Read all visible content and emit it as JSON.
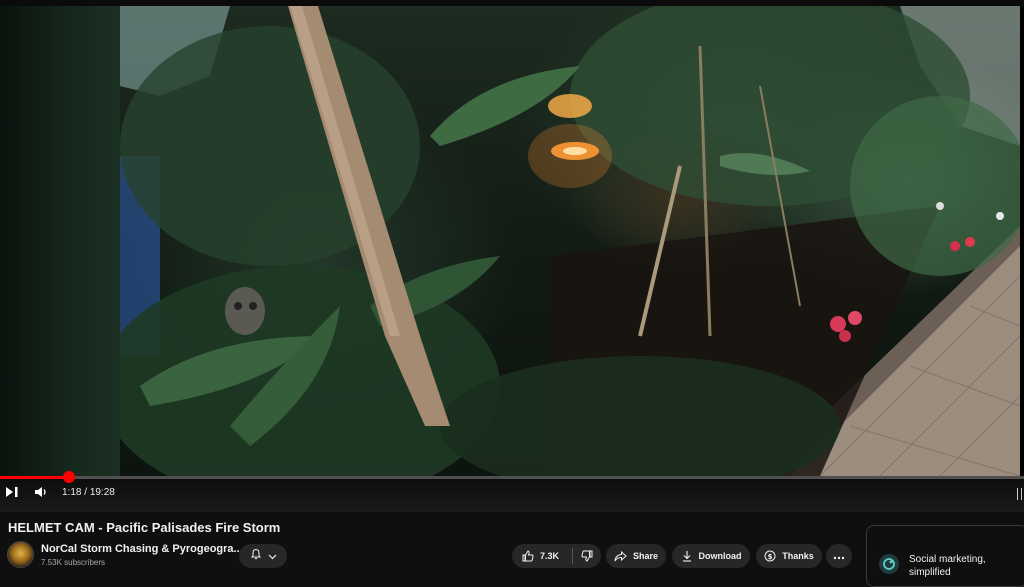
{
  "video": {
    "current_time": "1:18",
    "duration": "19:28",
    "progress_fraction": 0.067
  },
  "title": "HELMET CAM - Pacific Palisades Fire Storm",
  "channel": {
    "name": "NorCal Storm Chasing & Pyrogeogra...",
    "subscribers": "7.53K subscribers"
  },
  "actions": {
    "like_count": "7.3K",
    "share_label": "Share",
    "download_label": "Download",
    "thanks_label": "Thanks"
  },
  "ad": {
    "text": "Social marketing, simplified"
  },
  "icons": {
    "play_pause": "play-pause-icon",
    "volume": "volume-icon",
    "bell": "bell-icon",
    "chevron": "chevron-down-icon",
    "like": "thumbs-up-icon",
    "dislike": "thumbs-down-icon",
    "share": "share-icon",
    "download": "download-icon",
    "thanks": "thanks-icon",
    "more": "more-icon"
  },
  "colors": {
    "progress": "#ff0000",
    "background": "#0f0f0f",
    "pill": "#272727"
  }
}
